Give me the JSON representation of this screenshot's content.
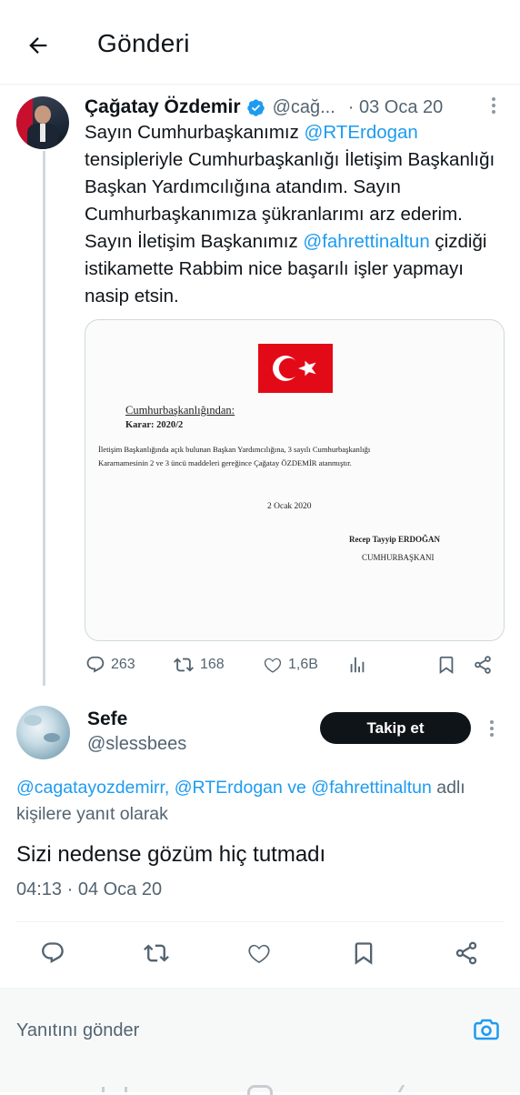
{
  "header": {
    "title": "Gönderi"
  },
  "tweet": {
    "author_name": "Çağatay Özdemir",
    "handle": "@cağ...",
    "date": "· 03 Oca 20",
    "text_part1": "Sayın Cumhurbaşkanımız ",
    "mention1": "@RTErdogan",
    "text_part2": " tensipleriyle Cumhurbaşkanlığı İletişim Başkanlığı  Başkan Yardımcılığına atandım. Sayın Cumhurbaşkanımıza şükranlarımı arz ederim. Sayın İletişim Başkanımız ",
    "mention2": "@fahrettinaltun",
    "text_part3": " çizdiği istikamette Rabbim nice başarılı işler yapmayı nasip etsin.",
    "document": {
      "heading": "Cumhurbaşkanlığından:",
      "decision": "Karar: 2020/2",
      "body_line1": "İletişim Başkanlığında açık bulunan Başkan Yardımcılığına, 3 sayılı Cumhurbaşkanlığı",
      "body_line2": "Kararnamesinin 2 ve 3 üncü maddeleri gereğince Çağatay ÖZDEMİR atanmıştır.",
      "date": "2 Ocak 2020",
      "signer": "Recep Tayyip ERDOĞAN",
      "title": "CUMHURBAŞKANI"
    },
    "stats": {
      "replies": "263",
      "retweets": "168",
      "likes": "1,6B"
    }
  },
  "reply": {
    "author_name": "Sefe",
    "handle": "@slessbees",
    "follow_label": "Takip et",
    "replying_mentions": "@cagatayozdemirr, @RTErdogan ve @fahrettinaltun",
    "replying_suffix": " adlı",
    "replying_line2": "kişilere yanıt olarak",
    "text": "Sizi nedense gözüm hiç tutmadı",
    "timestamp": "04:13 · 04 Oca 20"
  },
  "composer": {
    "placeholder": "Yanıtını gönder"
  },
  "colors": {
    "accent": "#1d9bf0",
    "verified": "#1d9bf0",
    "follow_bg": "#0f1419"
  }
}
